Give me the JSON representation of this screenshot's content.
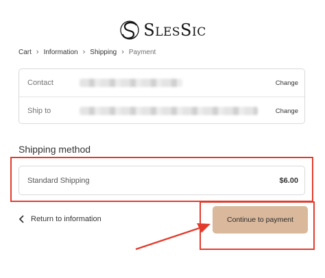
{
  "brand": {
    "name": "SlesSic"
  },
  "breadcrumb": {
    "items": [
      {
        "label": "Cart"
      },
      {
        "label": "Information"
      },
      {
        "label": "Shipping"
      },
      {
        "label": "Payment"
      }
    ]
  },
  "review": {
    "contact_label": "Contact",
    "ship_to_label": "Ship to",
    "change_label": "Change"
  },
  "shipping_method": {
    "heading": "Shipping method",
    "option_name": "Standard Shipping",
    "option_price": "$6.00"
  },
  "actions": {
    "return_label": "Return to information",
    "continue_label": "Continue to payment"
  },
  "annotations": {
    "highlight_color": "#e23b2c",
    "button_color": "#d9b89c"
  }
}
